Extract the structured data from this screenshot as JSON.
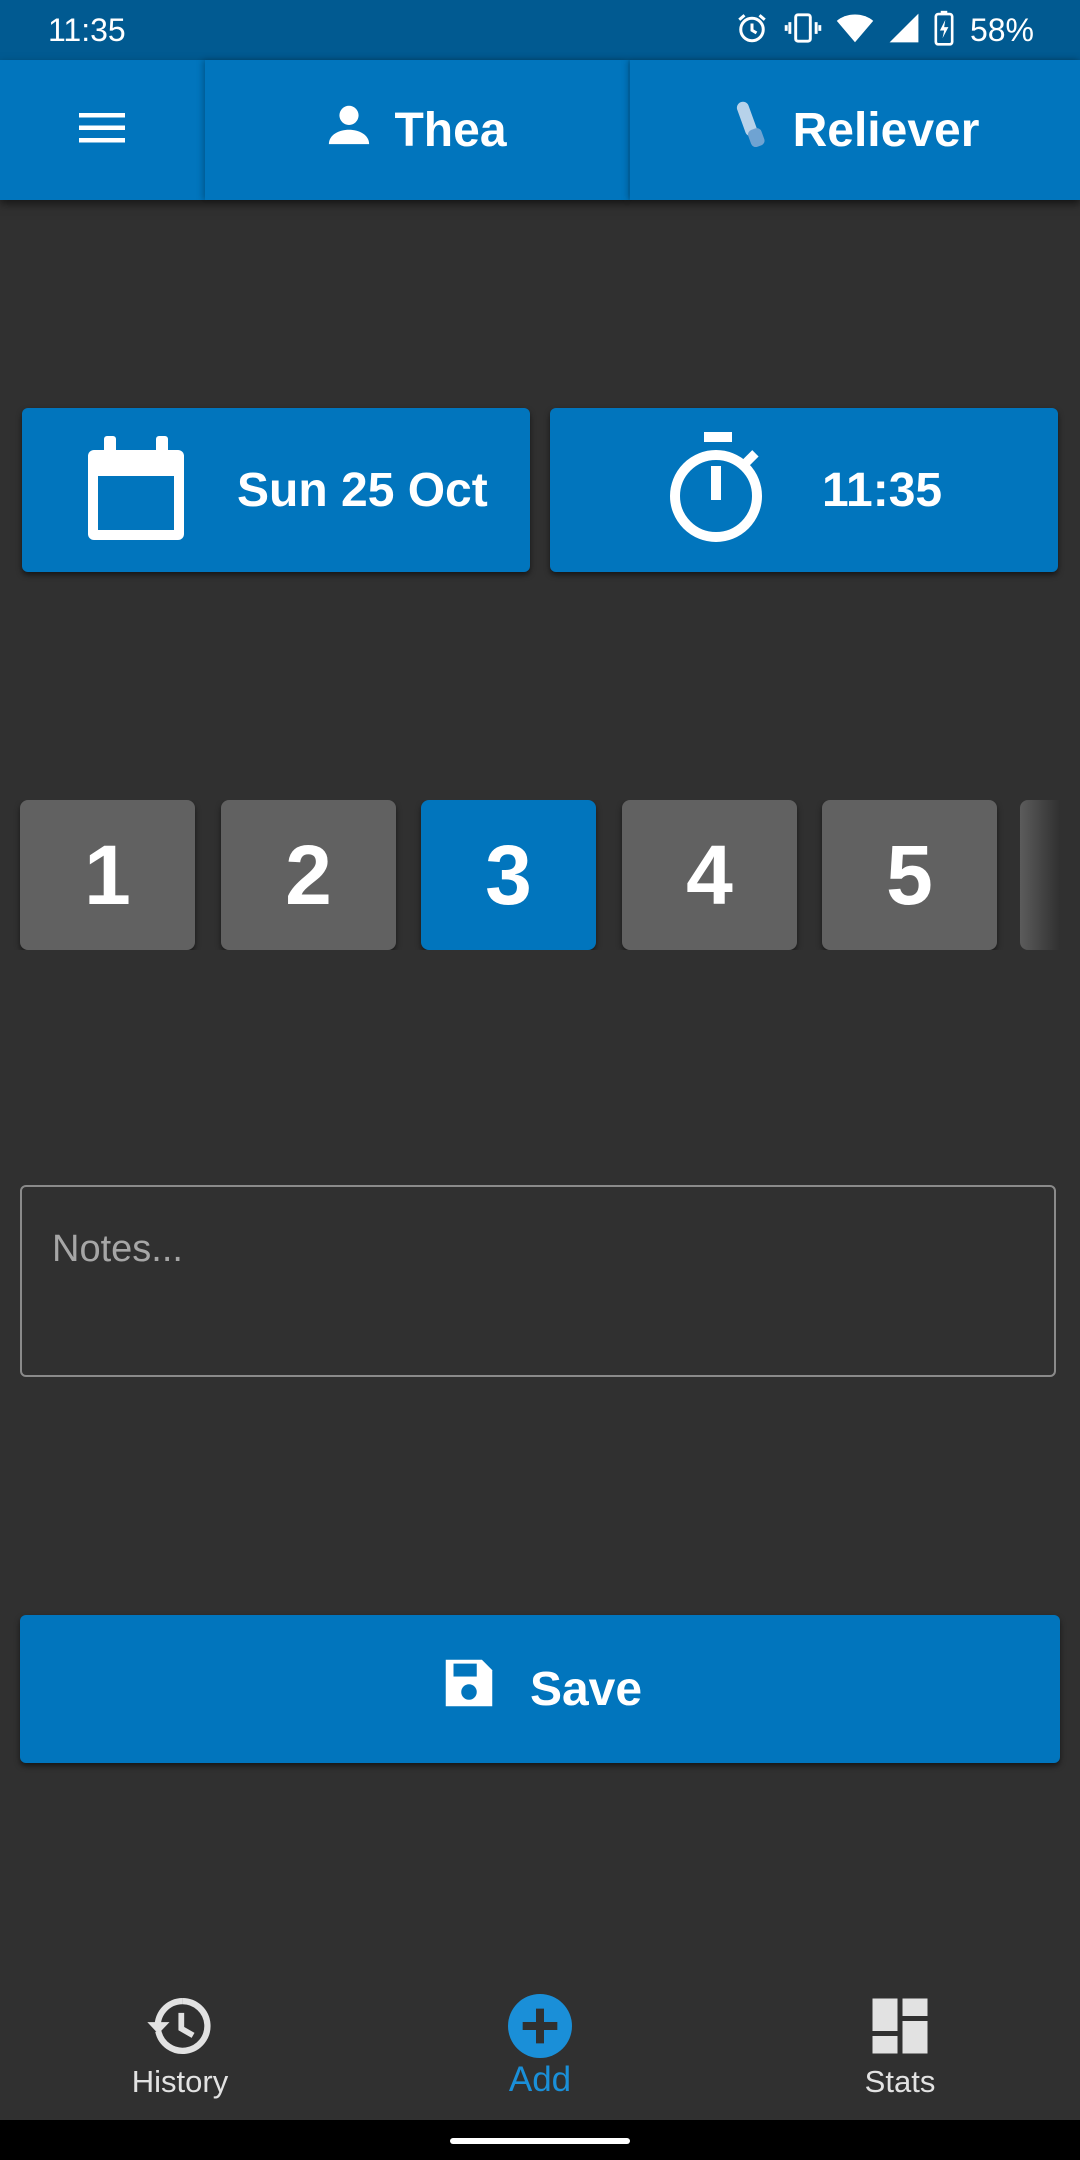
{
  "status_bar": {
    "time": "11:35",
    "battery": "58%",
    "icons": [
      "alarm-icon",
      "vibrate-icon",
      "wifi-icon",
      "signal-icon",
      "battery-charging-icon"
    ]
  },
  "app_bar": {
    "menu_icon": "hamburger-menu-icon",
    "person_tab": {
      "label": "Thea",
      "icon": "person-icon"
    },
    "medication_tab": {
      "label": "Reliever",
      "icon": "inhaler-icon"
    }
  },
  "date_button": {
    "label": "Sun 25 Oct",
    "icon": "calendar-icon"
  },
  "time_button": {
    "label": "11:35",
    "icon": "stopwatch-icon"
  },
  "doses": {
    "options": [
      "1",
      "2",
      "3",
      "4",
      "5"
    ],
    "selected": "3"
  },
  "notes": {
    "placeholder": "Notes...",
    "value": ""
  },
  "save_button": {
    "label": "Save",
    "icon": "floppy-disk-icon"
  },
  "bottom_nav": {
    "items": [
      {
        "label": "History",
        "icon": "history-icon",
        "active": false
      },
      {
        "label": "Add",
        "icon": "add-circle-icon",
        "active": true
      },
      {
        "label": "Stats",
        "icon": "dashboard-icon",
        "active": false
      }
    ]
  },
  "colors": {
    "primary": "#0175bd",
    "status_bar": "#015a91",
    "background": "#303030",
    "unselected_dose": "#616161",
    "active_nav": "#1a8fd8"
  }
}
